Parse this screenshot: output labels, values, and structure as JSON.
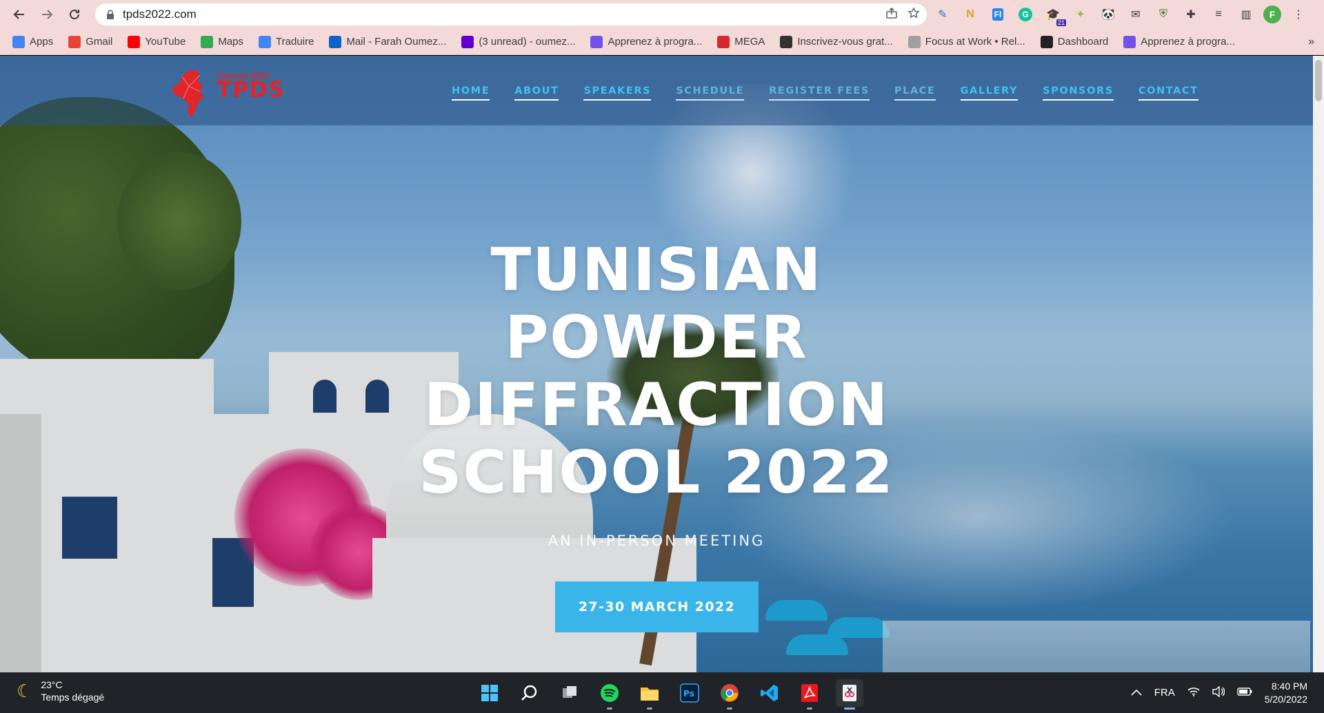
{
  "browser": {
    "url": "tpds2022.com",
    "profile_initial": "F",
    "extension_badge": "21",
    "bookmarks": [
      {
        "label": "Apps",
        "icon": "apps-grid-icon",
        "color": "#4285f4"
      },
      {
        "label": "Gmail",
        "icon": "gmail-icon",
        "color": "#ea4335"
      },
      {
        "label": "YouTube",
        "icon": "youtube-icon",
        "color": "#ff0000"
      },
      {
        "label": "Maps",
        "icon": "maps-icon",
        "color": "#34a853"
      },
      {
        "label": "Traduire",
        "icon": "translate-icon",
        "color": "#4285f4"
      },
      {
        "label": "Mail - Farah Oumez...",
        "icon": "outlook-icon",
        "color": "#0a64c8"
      },
      {
        "label": "(3 unread) - oumez...",
        "icon": "yahoo-mail-icon",
        "color": "#6001d2"
      },
      {
        "label": "Apprenez à progra...",
        "icon": "openclassrooms-icon",
        "color": "#7451eb"
      },
      {
        "label": "MEGA",
        "icon": "mega-icon",
        "color": "#d9272e"
      },
      {
        "label": "Inscrivez-vous grat...",
        "icon": "cisco-icon",
        "color": "#333333"
      },
      {
        "label": "Focus at Work • Rel...",
        "icon": "focus-icon",
        "color": "#a0a0a0"
      },
      {
        "label": "Dashboard",
        "icon": "moodle-icon",
        "color": "#222222"
      },
      {
        "label": "Apprenez à progra...",
        "icon": "openclassrooms-icon",
        "color": "#7451eb"
      }
    ]
  },
  "site": {
    "logo": {
      "year": "Tunisia  2022",
      "name": "TPDS"
    },
    "nav": [
      "HOME",
      "ABOUT",
      "SPEAKERS",
      "SCHEDULE",
      "REGISTER FEES",
      "PLACE",
      "GALLERY",
      "SPONSORS",
      "CONTACT"
    ],
    "hero": {
      "title_lines": [
        "TUNISIAN",
        "POWDER",
        "DIFFRACTION",
        "SCHOOL 2022"
      ],
      "subtitle": "AN IN-PERSON MEETING",
      "cta": "27-30 MARCH 2022"
    },
    "colors": {
      "accent": "#3ab5ea",
      "logo_red": "#e0252b"
    }
  },
  "taskbar": {
    "weather": {
      "temp": "23°C",
      "desc": "Temps dégagé"
    },
    "apps": [
      "windows-start-icon",
      "search-icon",
      "task-view-icon",
      "spotify-icon",
      "file-explorer-icon",
      "photoshop-icon",
      "chrome-icon",
      "vscode-icon",
      "acrobat-icon",
      "snipping-tool-icon"
    ],
    "tray": {
      "lang": "FRA",
      "time": "8:40 PM",
      "date": "5/20/2022"
    }
  }
}
